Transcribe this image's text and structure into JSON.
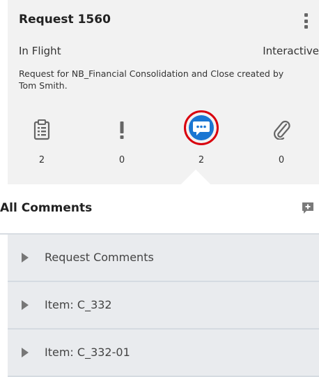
{
  "request": {
    "title": "Request 1560",
    "status": "In Flight",
    "mode": "Interactive",
    "description": "Request for NB_Financial Consolidation and Close created by Tom Smith."
  },
  "stats": [
    {
      "icon": "clipboard-icon",
      "count": "2"
    },
    {
      "icon": "exclamation-icon",
      "count": "0"
    },
    {
      "icon": "comment-icon",
      "count": "2"
    },
    {
      "icon": "paperclip-icon",
      "count": "0"
    }
  ],
  "comments": {
    "title": "All Comments",
    "sections": [
      {
        "label": "Request Comments"
      },
      {
        "label": "Item: C_332"
      },
      {
        "label": "Item: C_332-01"
      }
    ]
  },
  "colors": {
    "accent": "#1a76d2",
    "highlight_ring": "#d9000d"
  }
}
